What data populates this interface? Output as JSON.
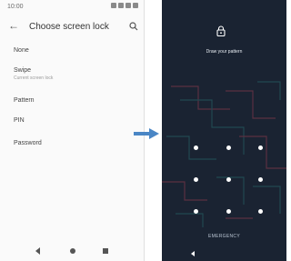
{
  "left_screen": {
    "status": {
      "time": "10:00"
    },
    "appbar": {
      "title": "Choose screen lock"
    },
    "items": [
      {
        "label": "None"
      },
      {
        "label": "Swipe",
        "subtitle": "Current screen lock"
      },
      {
        "label": "Pattern"
      },
      {
        "label": "PIN"
      },
      {
        "label": "Password"
      }
    ]
  },
  "right_screen": {
    "instruction": "Draw your pattern",
    "emergency_label": "EMERGENCY"
  },
  "colors": {
    "left_background": "#fafafa",
    "right_background": "#1a2332",
    "arrow": "#4a86c5",
    "pattern_dot": "#ffffff"
  },
  "icons": [
    "back-arrow-icon",
    "search-icon",
    "lock-icon",
    "nav-back-icon",
    "nav-home-icon",
    "nav-recents-icon",
    "flow-arrow-icon"
  ]
}
